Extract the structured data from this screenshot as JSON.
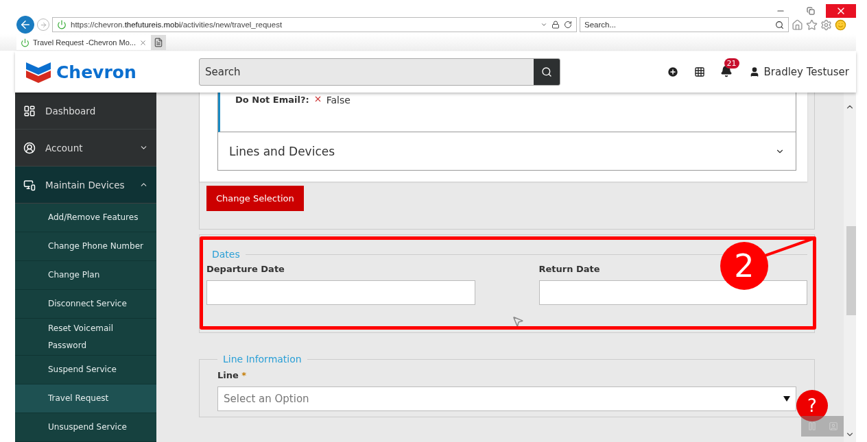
{
  "browser": {
    "url": "https://chevron.**thefutureis.mobi**/activities/new/travel_request",
    "search_placeholder": "Search...",
    "tab_title": "Travel Request -Chevron Mo..."
  },
  "header": {
    "brand": "Chevron",
    "search_placeholder": "Search",
    "notification_count": "21",
    "user_name": "Bradley Testuser"
  },
  "sidebar": {
    "items": [
      {
        "label": "Dashboard",
        "selected": false
      },
      {
        "label": "Account",
        "expanded": false,
        "selected": false
      },
      {
        "label": "Maintain Devices",
        "expanded": true,
        "selected": false,
        "children": [
          {
            "label": "Add/Remove Features",
            "selected": false
          },
          {
            "label": "Change Phone Number",
            "selected": false
          },
          {
            "label": "Change Plan",
            "selected": false
          },
          {
            "label": "Disconnect Service",
            "selected": false
          },
          {
            "label": "Reset Voicemail Password",
            "selected": false
          },
          {
            "label": "Suspend Service",
            "selected": false
          },
          {
            "label": "Travel Request",
            "selected": true
          },
          {
            "label": "Unsuspend Service",
            "selected": false
          }
        ]
      }
    ]
  },
  "contact_detail": {
    "label": "Do Not Email?:",
    "value": "False"
  },
  "accordion": {
    "title": "Lines and Devices",
    "expanded": false
  },
  "change_button": "Change Selection",
  "dates": {
    "legend": "Dates",
    "fields": [
      {
        "label": "Departure Date"
      },
      {
        "label": "Return Date"
      }
    ]
  },
  "line_information": {
    "legend": "Line Information",
    "field": {
      "label": "Line",
      "required_mark": "*",
      "placeholder": "Select an Option"
    }
  },
  "annotation": {
    "number": "2"
  },
  "help_button": "?"
}
